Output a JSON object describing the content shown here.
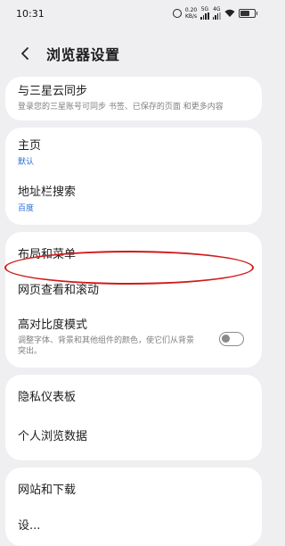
{
  "status_bar": {
    "time": "10:31",
    "speed_value": "0.20",
    "speed_unit": "KB/s",
    "sim1": "5G",
    "sim2": "4G"
  },
  "header": {
    "title": "浏览器设置"
  },
  "sync": {
    "title": "与三星云同步",
    "desc": "登录您的三星账号可同步 书签、已保存的页面 和更多内容"
  },
  "home": {
    "title": "主页",
    "value": "默认"
  },
  "search": {
    "title": "地址栏搜索",
    "value": "百度"
  },
  "layout": {
    "title": "布局和菜单"
  },
  "scroll": {
    "title": "网页查看和滚动"
  },
  "contrast": {
    "title": "高对比度模式",
    "desc": "调整字体、背景和其他组件的颜色，使它们从背景突出。",
    "toggle_on": false
  },
  "privacy": {
    "title": "隐私仪表板"
  },
  "personal": {
    "title": "个人浏览数据"
  },
  "sites": {
    "title": "网站和下载"
  },
  "partial": {
    "title": "设..."
  },
  "colors": {
    "annotation": "#d11a1a",
    "link_value": "#2b6fd6"
  }
}
